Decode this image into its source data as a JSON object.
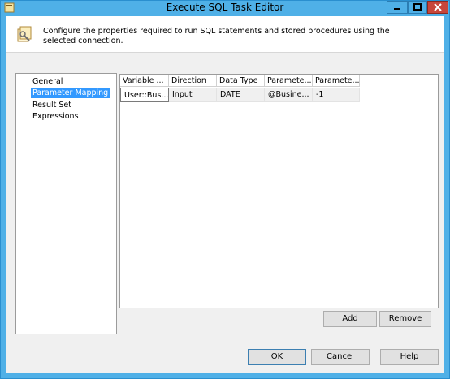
{
  "window": {
    "title": "Execute SQL Task Editor"
  },
  "header": {
    "description": "Configure the properties required to run SQL statements and stored procedures using the selected connection."
  },
  "nav": {
    "items": [
      "General",
      "Parameter Mapping",
      "Result Set",
      "Expressions"
    ],
    "selected": "Parameter Mapping"
  },
  "grid": {
    "columns": [
      "Variable ...",
      "Direction",
      "Data Type",
      "Paramete...",
      "Paramete..."
    ],
    "rows": [
      {
        "variable": "User::Bus...",
        "direction": "Input",
        "data_type": "DATE",
        "parameter_name": "@Busine...",
        "parameter_size": "-1"
      }
    ]
  },
  "buttons": {
    "add": "Add",
    "remove": "Remove",
    "ok": "OK",
    "cancel": "Cancel",
    "help": "Help"
  },
  "icons": {
    "app": "sql-task-icon",
    "header": "task-wrench-icon",
    "minimize": "minimize-icon",
    "maximize": "maximize-icon",
    "close": "close-icon"
  }
}
